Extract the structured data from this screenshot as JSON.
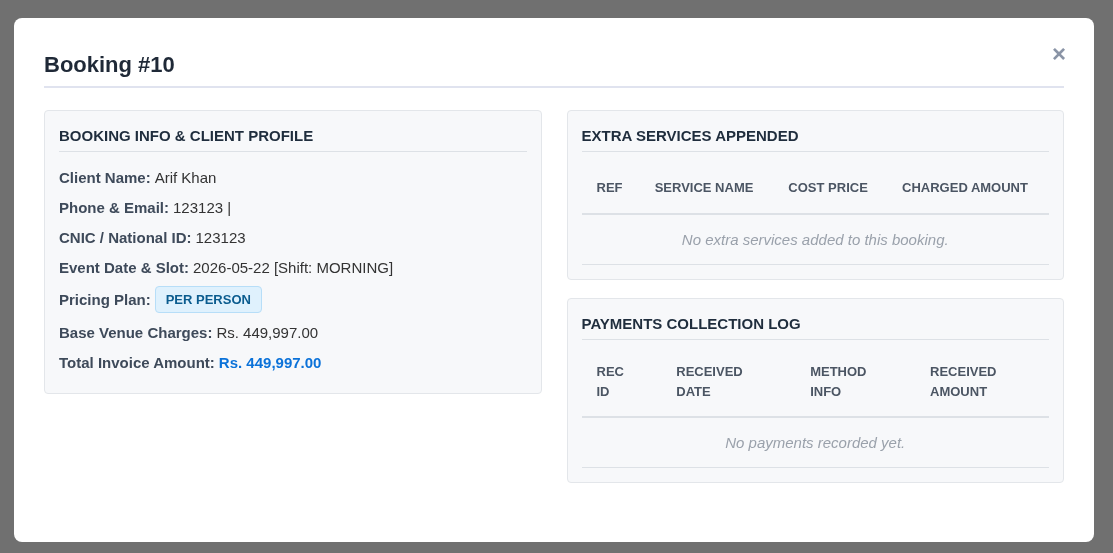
{
  "modal": {
    "title": "Booking #10",
    "close": "×"
  },
  "booking_info": {
    "title": "BOOKING INFO & CLIENT PROFILE",
    "fields": [
      {
        "label": "Client Name:",
        "value": "Arif Khan",
        "kind": "text"
      },
      {
        "label": "Phone & Email:",
        "value": "123123 |",
        "kind": "text"
      },
      {
        "label": "CNIC / National ID:",
        "value": "123123",
        "kind": "text"
      },
      {
        "label": "Event Date & Slot:",
        "value": "2026-05-22 [Shift: MORNING]",
        "kind": "text"
      },
      {
        "label": "Pricing Plan:",
        "value": "PER PERSON",
        "kind": "badge"
      },
      {
        "label": "Base Venue Charges:",
        "value": "Rs. 449,997.00",
        "kind": "text"
      },
      {
        "label": "Total Invoice Amount:",
        "value": "Rs. 449,997.00",
        "kind": "highlight"
      }
    ]
  },
  "extra_services": {
    "title": "EXTRA SERVICES APPENDED",
    "columns": [
      "REF",
      "SERVICE NAME",
      "COST PRICE",
      "CHARGED AMOUNT"
    ],
    "empty_message": "No extra services added to this booking."
  },
  "payments": {
    "title": "PAYMENTS COLLECTION LOG",
    "columns": [
      "REC ID",
      "RECEIVED DATE",
      "METHOD INFO",
      "RECEIVED AMOUNT"
    ],
    "empty_message": "No payments recorded yet."
  }
}
